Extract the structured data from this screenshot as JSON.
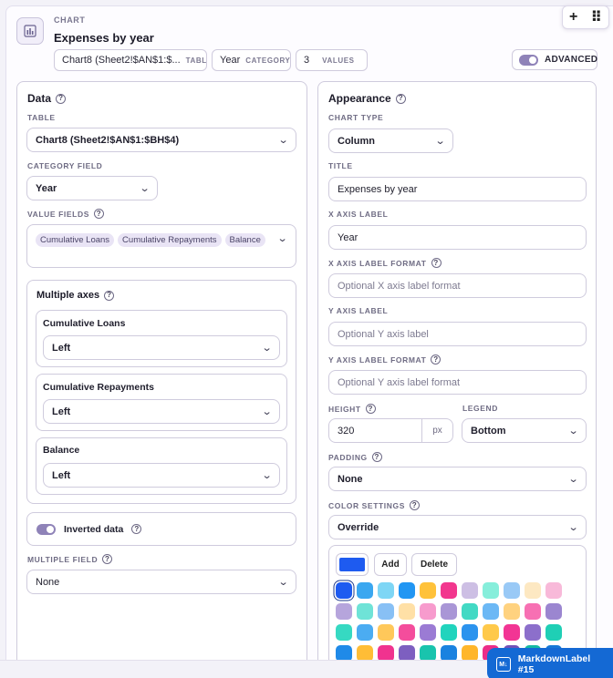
{
  "header": {
    "type_label": "CHART",
    "chart_title": "Expenses by year",
    "table_chip": {
      "value": "Chart8 (Sheet2!$AN$1:$...",
      "tag": "TABLE"
    },
    "category_chip": {
      "value": "Year",
      "tag": "CATEGORY"
    },
    "values_chip": {
      "value": "3",
      "tag": "VALUES"
    },
    "advanced_label": "ADVANCED",
    "add_glyph": "+",
    "drag_glyph": "⠿"
  },
  "data_panel": {
    "title": "Data",
    "table_label": "TABLE",
    "table_value": "Chart8 (Sheet2!$AN$1:$BH$4)",
    "category_label": "CATEGORY FIELD",
    "category_value": "Year",
    "value_fields_label": "VALUE FIELDS",
    "value_fields": [
      "Cumulative Loans",
      "Cumulative Repayments",
      "Balance"
    ],
    "multiple_axes_title": "Multiple axes",
    "axes": [
      {
        "name": "Cumulative Loans",
        "value": "Left"
      },
      {
        "name": "Cumulative Repayments",
        "value": "Left"
      },
      {
        "name": "Balance",
        "value": "Left"
      }
    ],
    "inverted_label": "Inverted data",
    "multiple_field_label": "MULTIPLE FIELD",
    "multiple_field_value": "None"
  },
  "appearance_panel": {
    "title": "Appearance",
    "chart_type_label": "CHART TYPE",
    "chart_type_value": "Column",
    "title_label": "TITLE",
    "title_value": "Expenses by year",
    "x_axis_label_label": "X AXIS LABEL",
    "x_axis_label_value": "Year",
    "x_axis_format_label": "X AXIS LABEL FORMAT",
    "x_axis_format_placeholder": "Optional X axis label format",
    "y_axis_label_label": "Y AXIS LABEL",
    "y_axis_label_placeholder": "Optional Y axis label",
    "y_axis_format_label": "Y AXIS LABEL FORMAT",
    "y_axis_format_placeholder": "Optional Y axis label format",
    "height_label": "HEIGHT",
    "height_value": "320",
    "height_unit": "px",
    "legend_label": "LEGEND",
    "legend_value": "Bottom",
    "padding_label": "PADDING",
    "padding_value": "None",
    "color_settings_label": "COLOR SETTINGS",
    "color_settings_value": "Override",
    "selected_color": "#1e5bf0",
    "add_label": "Add",
    "delete_label": "Delete",
    "palette_rows": [
      [
        "#1e5bf0",
        "#3aa7f0",
        "#7ed6f5",
        "#2196f3",
        "#ffc23a",
        "#f2378e",
        "#cdbfe4",
        "#86eedb",
        "#99c9f6",
        "#fde8c2",
        "#f8b9d9"
      ],
      [
        "#b6a5dc",
        "#6fe3d7",
        "#88c0f5",
        "#ffe0a6",
        "#f79bcd",
        "#a996d6",
        "#42d9c4",
        "#6cb8f5",
        "#ffd27f",
        "#f770b3",
        "#9b86d0"
      ],
      [
        "#36d9c2",
        "#4bacf2",
        "#ffc85a",
        "#f44d9c",
        "#9b7bd4",
        "#21d4bd",
        "#2b93ee",
        "#ffc94a",
        "#f23594",
        "#8c6fcb",
        "#1fcfb5"
      ],
      [
        "#1f8ae8",
        "#ffbd36",
        "#f0338f",
        "#7d5fc0",
        "#19c4ad",
        "#1a82e0",
        "#ffb62a",
        "#ec2d88",
        "#7252b8",
        "#16b9a3",
        "#1678d6"
      ]
    ]
  },
  "footer": {
    "component_name": "MarkdownLabel #15"
  }
}
